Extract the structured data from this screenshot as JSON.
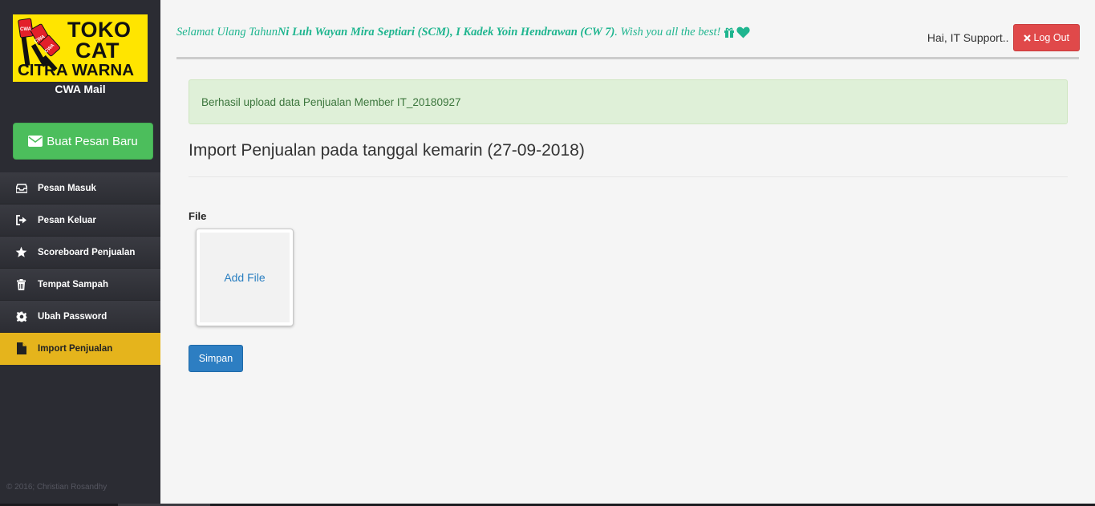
{
  "brand": {
    "logo_line1": "TOKO",
    "logo_line2": "CAT",
    "logo_line3": "CITRA WARNA",
    "logo_badge": "CWA",
    "app_name": "CWA Mail",
    "colors": {
      "logo_bg": "#ffe500",
      "logo_red": "#e3202a"
    }
  },
  "sidebar": {
    "compose_label": "Buat Pesan Baru",
    "compose_icon": "envelope-icon",
    "items": [
      {
        "label": "Pesan Masuk",
        "icon": "inbox-icon",
        "active": false
      },
      {
        "label": "Pesan Keluar",
        "icon": "sign-out-icon",
        "active": false
      },
      {
        "label": "Scoreboard Penjualan",
        "icon": "star-icon",
        "active": false
      },
      {
        "label": "Tempat Sampah",
        "icon": "trash-icon",
        "active": false
      },
      {
        "label": "Ubah Password",
        "icon": "gear-icon",
        "active": false
      },
      {
        "label": "Import Penjualan",
        "icon": "file-icon",
        "active": true
      }
    ],
    "footer": "© 2016; Christian Rosandhy",
    "colors": {
      "bg": "#2b2c33",
      "active": "#e5b41c",
      "compose": "#4cbe5c"
    }
  },
  "header": {
    "greeting_prefix": "Selamat Ulang Tahun ",
    "greeting_names": "Ni Luh Wayan Mira Septiari (SCM), I Kadek Yoin Hendrawan (CW 7)",
    "greeting_suffix": ". Wish you all the best!",
    "greeting_icons": [
      "gift-icon",
      "heart-icon"
    ],
    "user_greeting": "Hai, IT Support..",
    "logout_label": "Log Out",
    "logout_icon": "close-icon",
    "colors": {
      "greeting": "#1fb58f",
      "logout": "#e0494a"
    }
  },
  "main": {
    "alert_text": "Berhasil upload data Penjualan Member IT_20180927",
    "title": "Import Penjualan pada tanggal kemarin (27-09-2018)",
    "file_label": "File",
    "add_file_label": "Add File",
    "save_label": "Simpan",
    "colors": {
      "alert_bg": "#dff0d8",
      "alert_text": "#3c763d",
      "save": "#2d7ec2"
    }
  }
}
